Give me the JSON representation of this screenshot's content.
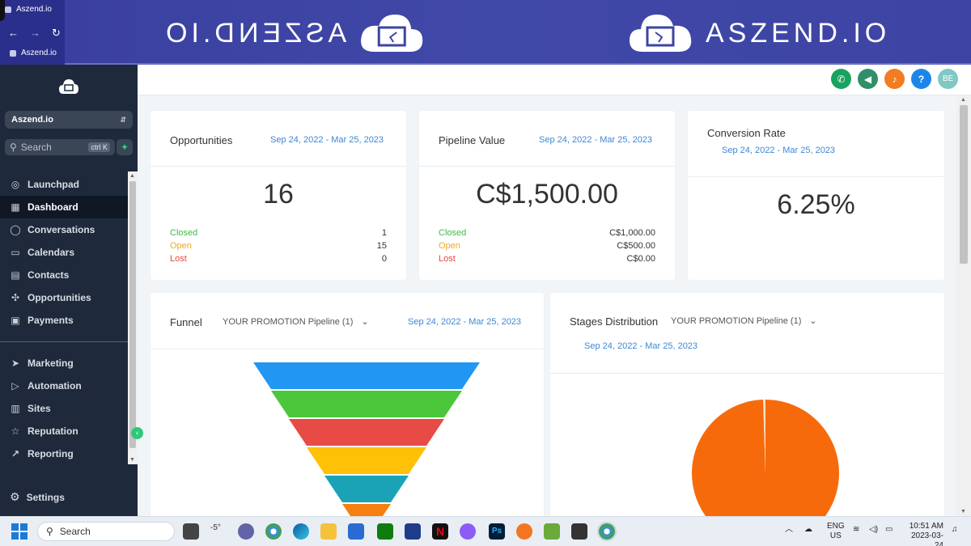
{
  "browser": {
    "tab_title": "Aszend.io",
    "tab2_title": "Aszend.io",
    "back": "←",
    "forward": "→",
    "reload": "↻"
  },
  "banner": {
    "brand_text": "ASZEND.IO"
  },
  "sidebar": {
    "account_name": "Aszend.io",
    "search_placeholder": "Search",
    "search_shortcut": "ctrl K",
    "items": [
      {
        "label": "Launchpad",
        "icon": "rocket-icon"
      },
      {
        "label": "Dashboard",
        "icon": "grid-icon"
      },
      {
        "label": "Conversations",
        "icon": "chat-icon"
      },
      {
        "label": "Calendars",
        "icon": "calendar-icon"
      },
      {
        "label": "Contacts",
        "icon": "contacts-icon"
      },
      {
        "label": "Opportunities",
        "icon": "network-icon"
      },
      {
        "label": "Payments",
        "icon": "receipt-icon"
      }
    ],
    "items2": [
      {
        "label": "Marketing",
        "icon": "send-icon"
      },
      {
        "label": "Automation",
        "icon": "play-circle-icon"
      },
      {
        "label": "Sites",
        "icon": "sites-icon"
      },
      {
        "label": "Reputation",
        "icon": "star-icon"
      },
      {
        "label": "Reporting",
        "icon": "chart-line-icon"
      }
    ],
    "settings_label": "Settings"
  },
  "topbar": {
    "avatar_initials": "BE",
    "help": "?"
  },
  "cards": {
    "opportunities": {
      "title": "Opportunities",
      "date": "Sep 24, 2022 - Mar 25, 2023",
      "value": "16",
      "closed_label": "Closed",
      "closed_value": "1",
      "open_label": "Open",
      "open_value": "15",
      "lost_label": "Lost",
      "lost_value": "0"
    },
    "pipeline": {
      "title": "Pipeline Value",
      "date": "Sep 24, 2022 - Mar 25, 2023",
      "value": "C$1,500.00",
      "closed_label": "Closed",
      "closed_value": "C$1,000.00",
      "open_label": "Open",
      "open_value": "C$500.00",
      "lost_label": "Lost",
      "lost_value": "C$0.00"
    },
    "conversion": {
      "title": "Conversion Rate",
      "date": "Sep 24, 2022 - Mar 25, 2023",
      "value": "6.25%"
    },
    "funnel": {
      "title": "Funnel",
      "pipeline": "YOUR PROMOTION Pipeline (1)",
      "date": "Sep 24, 2022 - Mar 25, 2023"
    },
    "stages": {
      "title": "Stages Distribution",
      "pipeline": "YOUR PROMOTION Pipeline (1)",
      "date": "Sep 24, 2022 - Mar 25, 2023"
    }
  },
  "chart_data": [
    {
      "type": "funnel",
      "stage_colors": [
        "#2196f3",
        "#4cc63a",
        "#e84a45",
        "#ffc107",
        "#1aa3b7",
        "#f5800f"
      ]
    },
    {
      "type": "pie",
      "values": [
        99.5,
        0.5
      ],
      "colors": [
        "#f76a0c",
        "#f4e3c4"
      ]
    }
  ],
  "taskbar": {
    "search_placeholder": "Search",
    "weather": "-5°",
    "lang": "ENG",
    "region": "US",
    "time": "10:51 AM",
    "date": "2023-03-24"
  }
}
